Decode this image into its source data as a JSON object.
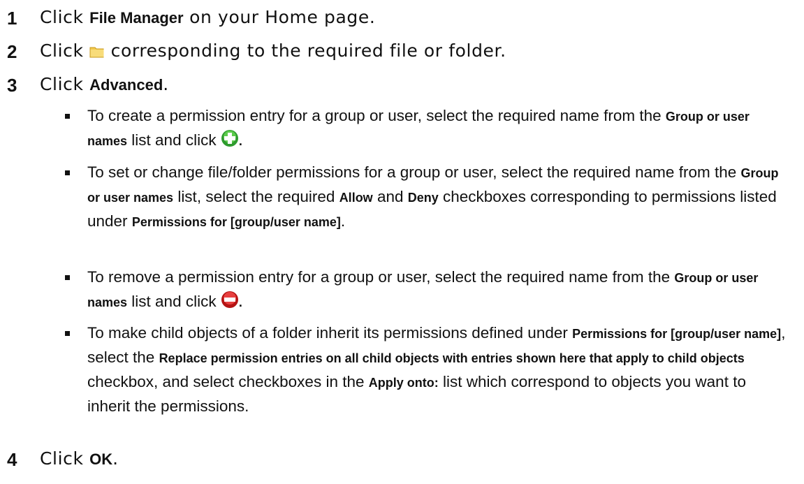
{
  "steps": [
    {
      "number": "1",
      "pre": "Click ",
      "bold": "File Manager",
      "post": " on your Home page."
    },
    {
      "number": "2",
      "pre": "Click ",
      "icon": "folder-icon",
      "post": " corresponding to the required file or folder."
    },
    {
      "number": "3",
      "pre": "Click ",
      "bold": "Advanced",
      "post": "."
    },
    {
      "number": "4",
      "pre": "Click ",
      "bold": "OK",
      "post": "."
    }
  ],
  "bullets": [
    {
      "t1": "To create a permission entry for a group or user, select the required name from the ",
      "b1": "Group or user names",
      "t2": " list and click ",
      "icon": "add-icon",
      "t3": "."
    },
    {
      "t1": "To set or change file/folder permissions for a group or user, select the required name from the ",
      "b1": "Group or user names",
      "t2": " list, select the required ",
      "b2": "Allow",
      "t3": " and ",
      "b3": "Deny",
      "t4": " checkboxes corresponding to permissions listed under ",
      "b4": "Permissions for [group/user name]",
      "t5": "."
    },
    {
      "t1": "To remove a permission entry for a group or user, select the required name from the ",
      "b1": "Group or user names",
      "t2": " list and click ",
      "icon": "remove-icon",
      "t3": "."
    },
    {
      "t1": "To make child objects of a folder inherit its permissions defined under ",
      "b1": "Permissions for [group/user name]",
      "t2": ", select the ",
      "b2": "Replace permission entries on all child objects with entries shown here that apply to child objects",
      "t3": " checkbox, and select checkboxes in the ",
      "b3": "Apply onto:",
      "t4": " list which correspond to objects you want to inherit the permissions."
    }
  ],
  "colors": {
    "text": "#111111",
    "folder": "#f2c94c",
    "add": "#2e9b2e",
    "remove": "#d32020"
  }
}
